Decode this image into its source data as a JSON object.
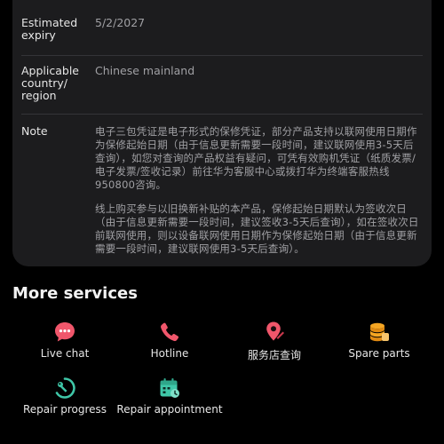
{
  "details": {
    "expiry": {
      "label": "Estimated expiry",
      "value": "5/2/2027"
    },
    "region": {
      "label": "Applicable country/ region",
      "value": "Chinese mainland"
    },
    "note": {
      "label": "Note",
      "paragraphs": [
        "电子三包凭证是电子形式的保修凭证，部分产品支持以联网使用日期作为保修起始日期（由于信息更新需要一段时间，建议联网使用3-5天后查询），如您对查询的产品权益有疑问，可凭有效购机凭证（纸质发票/电子发票/签收记录）前往华为客服中心或拨打华为终端客服热线950800咨询。",
        "线上购买参与以旧换新补贴的本产品，保修起始日期默认为签收次日（由于信息更新需要一段时间，建议签收3-5天后查询），如在签收次日前联网使用，则以设备联网使用日期作为保修起始日期（由于信息更新需要一段时间，建议联网使用3-5天后查询）。"
      ]
    }
  },
  "more_services": {
    "title": "More services",
    "items": [
      {
        "label": "Live chat",
        "icon": "chat-bubble-icon",
        "color": "#f0566b"
      },
      {
        "label": "Hotline",
        "icon": "phone-icon",
        "color": "#f0566b"
      },
      {
        "label": "服务店查询",
        "icon": "location-pin-icon",
        "color": "#f0566b"
      },
      {
        "label": "Spare parts",
        "icon": "parts-stack-icon",
        "color": "#f5a623"
      },
      {
        "label": "Repair progress",
        "icon": "wrench-progress-icon",
        "color": "#3fc7a8"
      },
      {
        "label": "Repair appointment",
        "icon": "calendar-clock-icon",
        "color": "#3fc7a8"
      }
    ]
  }
}
